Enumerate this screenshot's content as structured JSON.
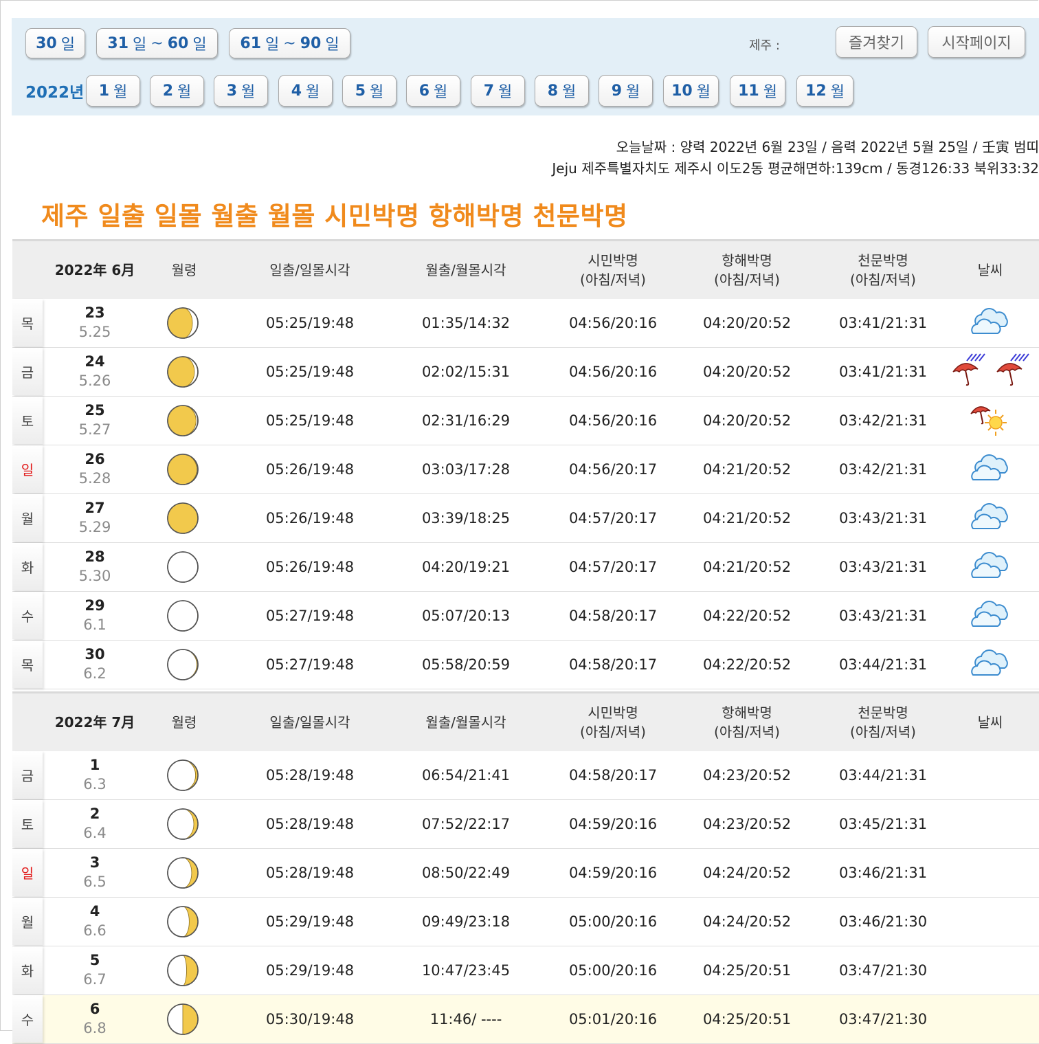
{
  "nav": {
    "range_buttons": [
      {
        "num": "30",
        "unit": "일"
      },
      {
        "num": "31",
        "unit": "일",
        "sep": "~",
        "num2": "60",
        "unit2": "일"
      },
      {
        "num": "61",
        "unit": "일",
        "sep": "~",
        "num2": "90",
        "unit2": "일"
      }
    ],
    "location_label": "제주 :",
    "favorite_label": "즐겨찾기",
    "homepage_label": "시작페이지",
    "year_label": "2022년",
    "month_buttons": [
      {
        "num": "1",
        "unit": "월"
      },
      {
        "num": "2",
        "unit": "월"
      },
      {
        "num": "3",
        "unit": "월"
      },
      {
        "num": "4",
        "unit": "월"
      },
      {
        "num": "5",
        "unit": "월"
      },
      {
        "num": "6",
        "unit": "월"
      },
      {
        "num": "7",
        "unit": "월"
      },
      {
        "num": "8",
        "unit": "월"
      },
      {
        "num": "9",
        "unit": "월"
      },
      {
        "num": "10",
        "unit": "월"
      },
      {
        "num": "11",
        "unit": "월"
      },
      {
        "num": "12",
        "unit": "월"
      }
    ]
  },
  "info": {
    "line1": "오늘날짜 : 양력 2022년 6월 23일 / 음력 2022년 5월 25일 / 壬寅 범띠",
    "line2": "Jeju 제주특별자치도 제주시 이도2동 평균해면하:139cm / 동경126:33 북위33:32"
  },
  "page_title": "제주 일출 일몰 월출 월몰 시민박명 항해박명 천문박명",
  "columns": {
    "moon_age": "월령",
    "sun": "일출/일몰시각",
    "moonrise": "월출/월몰시각",
    "civil": "시민박명",
    "nautical": "항해박명",
    "astro": "천문박명",
    "sub": "(아침/저녁)",
    "weather": "날씨"
  },
  "tables": [
    {
      "month": "2022年 6月",
      "rows": [
        {
          "dow": "목",
          "sunday": false,
          "day": "23",
          "lunar": "5.25",
          "phase": 0.86,
          "sun": "05:25/19:48",
          "moon": "01:35/14:32",
          "civil": "04:56/20:16",
          "nautical": "04:20/20:52",
          "astro": "03:41/21:31",
          "weather": [
            "cloudy-icon"
          ]
        },
        {
          "dow": "금",
          "sunday": false,
          "day": "24",
          "lunar": "5.26",
          "phase": 0.89,
          "sun": "05:25/19:48",
          "moon": "02:02/15:31",
          "civil": "04:56/20:16",
          "nautical": "04:20/20:52",
          "astro": "03:41/21:31",
          "weather": [
            "rain-umbrella-icon",
            "rain-umbrella-icon"
          ]
        },
        {
          "dow": "토",
          "sunday": false,
          "day": "25",
          "lunar": "5.27",
          "phase": 0.92,
          "sun": "05:25/19:48",
          "moon": "02:31/16:29",
          "civil": "04:56/20:16",
          "nautical": "04:20/20:52",
          "astro": "03:42/21:31",
          "weather": [
            "umbrella-sun-icon"
          ]
        },
        {
          "dow": "일",
          "sunday": true,
          "day": "26",
          "lunar": "5.28",
          "phase": 0.94,
          "sun": "05:26/19:48",
          "moon": "03:03/17:28",
          "civil": "04:56/20:17",
          "nautical": "04:21/20:52",
          "astro": "03:42/21:31",
          "weather": [
            "cloudy-icon"
          ]
        },
        {
          "dow": "월",
          "sunday": false,
          "day": "27",
          "lunar": "5.29",
          "phase": 0.97,
          "sun": "05:26/19:48",
          "moon": "03:39/18:25",
          "civil": "04:57/20:17",
          "nautical": "04:21/20:52",
          "astro": "03:43/21:31",
          "weather": [
            "cloudy-icon"
          ]
        },
        {
          "dow": "화",
          "sunday": false,
          "day": "28",
          "lunar": "5.30",
          "phase": 0.0,
          "sun": "05:26/19:48",
          "moon": "04:20/19:21",
          "civil": "04:57/20:17",
          "nautical": "04:21/20:52",
          "astro": "03:43/21:31",
          "weather": [
            "cloudy-icon"
          ]
        },
        {
          "dow": "수",
          "sunday": false,
          "day": "29",
          "lunar": "6.1",
          "phase": 0.03,
          "sun": "05:27/19:48",
          "moon": "05:07/20:13",
          "civil": "04:58/20:17",
          "nautical": "04:22/20:52",
          "astro": "03:43/21:31",
          "weather": [
            "cloudy-icon"
          ]
        },
        {
          "dow": "목",
          "sunday": false,
          "day": "30",
          "lunar": "6.2",
          "phase": 0.06,
          "sun": "05:27/19:48",
          "moon": "05:58/20:59",
          "civil": "04:58/20:17",
          "nautical": "04:22/20:52",
          "astro": "03:44/21:31",
          "weather": [
            "cloudy-icon"
          ]
        }
      ]
    },
    {
      "month": "2022年 7月",
      "rows": [
        {
          "dow": "금",
          "sunday": false,
          "day": "1",
          "lunar": "6.3",
          "phase": 0.09,
          "sun": "05:28/19:48",
          "moon": "06:54/21:41",
          "civil": "04:58/20:17",
          "nautical": "04:23/20:52",
          "astro": "03:44/21:31",
          "weather": []
        },
        {
          "dow": "토",
          "sunday": false,
          "day": "2",
          "lunar": "6.4",
          "phase": 0.12,
          "sun": "05:28/19:48",
          "moon": "07:52/22:17",
          "civil": "04:59/20:16",
          "nautical": "04:23/20:52",
          "astro": "03:45/21:31",
          "weather": []
        },
        {
          "dow": "일",
          "sunday": true,
          "day": "3",
          "lunar": "6.5",
          "phase": 0.15,
          "sun": "05:28/19:48",
          "moon": "08:50/22:49",
          "civil": "04:59/20:16",
          "nautical": "04:24/20:52",
          "astro": "03:46/21:31",
          "weather": []
        },
        {
          "dow": "월",
          "sunday": false,
          "day": "4",
          "lunar": "6.6",
          "phase": 0.18,
          "sun": "05:29/19:48",
          "moon": "09:49/23:18",
          "civil": "05:00/20:16",
          "nautical": "04:24/20:52",
          "astro": "03:46/21:30",
          "weather": []
        },
        {
          "dow": "화",
          "sunday": false,
          "day": "5",
          "lunar": "6.7",
          "phase": 0.21,
          "sun": "05:29/19:48",
          "moon": "10:47/23:45",
          "civil": "05:00/20:16",
          "nautical": "04:25/20:51",
          "astro": "03:47/21:30",
          "weather": []
        },
        {
          "dow": "수",
          "sunday": false,
          "day": "6",
          "lunar": "6.8",
          "phase": 0.25,
          "today": true,
          "sun": "05:30/19:48",
          "moon": "11:46/ ----",
          "civil": "05:01/20:16",
          "nautical": "04:25/20:51",
          "astro": "03:47/21:30",
          "weather": []
        }
      ]
    }
  ],
  "colors": {
    "accent_blue": "#1f5fa6",
    "title_orange": "#f08a1c",
    "moon_yellow": "#f2c94c",
    "sunday_red": "#e21b1b"
  }
}
